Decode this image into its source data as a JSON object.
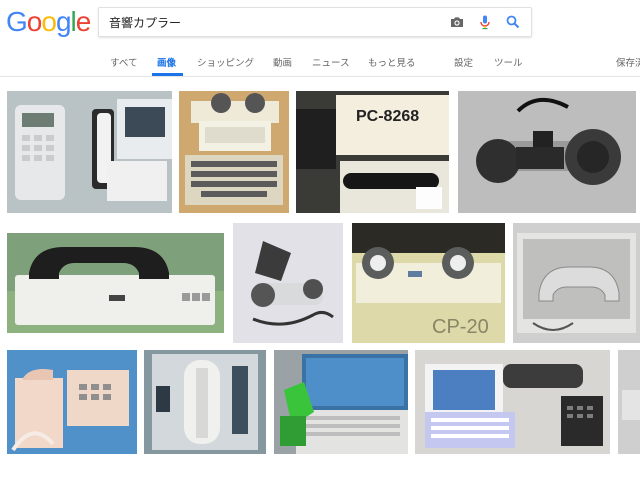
{
  "logo": {
    "text": "Google",
    "letters": [
      "G",
      "o",
      "o",
      "g",
      "l",
      "e"
    ],
    "colors": [
      "#4285F4",
      "#EA4335",
      "#FBBC05",
      "#4285F4",
      "#34A853",
      "#EA4335"
    ]
  },
  "search": {
    "query": "音響カプラー",
    "camera_icon": "camera-icon",
    "mic_icon": "mic-icon",
    "search_icon": "search-icon"
  },
  "tabs": {
    "items": [
      {
        "label": "すべて",
        "active": false
      },
      {
        "label": "画像",
        "active": true
      },
      {
        "label": "ショッピング",
        "active": false
      },
      {
        "label": "動画",
        "active": false
      },
      {
        "label": "ニュース",
        "active": false
      },
      {
        "label": "もっと見る",
        "active": false
      }
    ],
    "settings": "設定",
    "tools": "ツール",
    "safe_search": "保存済"
  },
  "accent_color": "#1a73e8",
  "results": {
    "images": [
      {
        "subject": "office-phone-with-acoustic-coupler"
      },
      {
        "subject": "vintage-printer-terminal-with-coupler"
      },
      {
        "subject": "pc-8268-coupler-box"
      },
      {
        "subject": "coupler-cups-with-handset"
      },
      {
        "subject": "black-handset-on-coupler"
      },
      {
        "subject": "portable-grey-coupler"
      },
      {
        "subject": "epson-cp-20-coupler"
      },
      {
        "subject": "coupler-in-case"
      },
      {
        "subject": "pink-payphone-with-coupler"
      },
      {
        "subject": "wall-panel-phone-coupler"
      },
      {
        "subject": "laptop-with-green-coupler"
      },
      {
        "subject": "mini-laptop-with-coupler-and-phone"
      },
      {
        "subject": "partial-result"
      }
    ]
  }
}
